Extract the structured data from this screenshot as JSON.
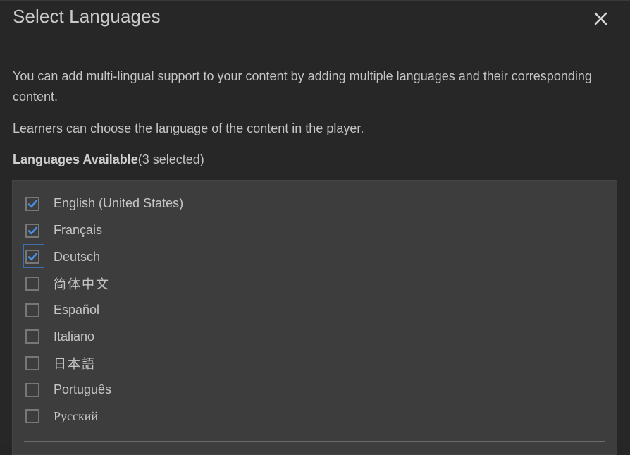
{
  "dialog": {
    "title": "Select Languages",
    "close_icon": "close-icon",
    "description": [
      "You can add multi-lingual support to your content by adding multiple languages and their corresponding content.",
      "Learners can choose the language of the content in the player."
    ],
    "available_label": "Languages Available",
    "selected_count_text": "(3 selected)",
    "colors": {
      "background": "#272727",
      "panel": "#3d3d3d",
      "checkmark": "#4a90e2",
      "focus_ring": "#3d6fb0",
      "text": "#c6c6c6"
    },
    "languages": [
      {
        "label": "English (United States)",
        "checked": true
      },
      {
        "label": "Français",
        "checked": true
      },
      {
        "label": "Deutsch",
        "checked": true,
        "focused": true
      },
      {
        "label": "简体中文",
        "checked": false
      },
      {
        "label": "Español",
        "checked": false
      },
      {
        "label": "Italiano",
        "checked": false
      },
      {
        "label": "日本語",
        "checked": false
      },
      {
        "label": "Português",
        "checked": false
      },
      {
        "label": "Русский",
        "checked": false
      }
    ]
  }
}
